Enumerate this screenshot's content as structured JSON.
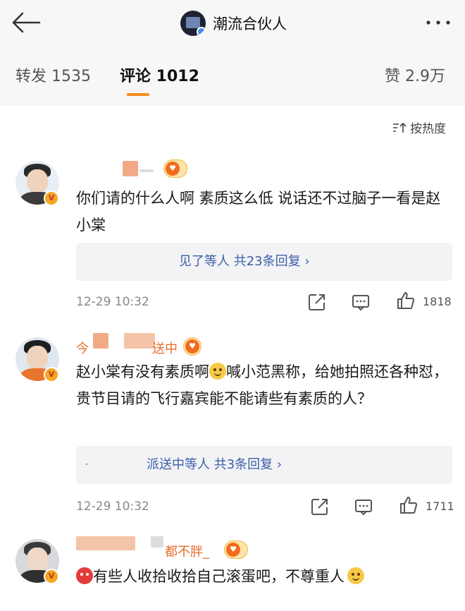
{
  "header": {
    "title": "潮流合伙人"
  },
  "tabs": {
    "repost": "转发 1535",
    "comment": "评论 1012",
    "like": "赞 2.9万"
  },
  "sort": {
    "label": "按热度"
  },
  "comments": [
    {
      "text": "你们请的什么人啊 素质这么低 说话还不过脑子一看是赵小棠",
      "replies": "见了等人  共23条回复 ›",
      "time": "12-29 10:32",
      "likes": "1818"
    },
    {
      "username_prefix": "今",
      "username_suffix": "送中",
      "text_part1": "赵小棠有没有素质啊",
      "text_part2": "喊小范黑称，给她拍照还各种怼，贵节目请的飞行嘉宾能不能请些有素质的人？",
      "replies_dot": "·",
      "replies": "派送中等人  共3条回复 ›",
      "time": "12-29 10:32",
      "likes": "1711"
    },
    {
      "username_suffix": "都不胖_",
      "text": "有些人收拾收拾自己滚蛋吧，不尊重人"
    }
  ],
  "colors": {
    "username": "#e86e2c",
    "reply_link": "#3b5ea8",
    "tab_underline": "#f78b1f"
  }
}
